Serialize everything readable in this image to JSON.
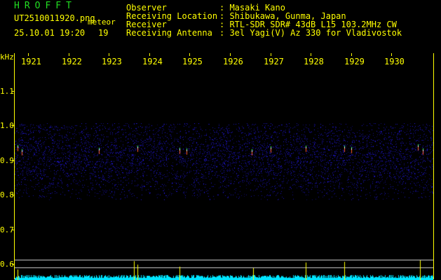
{
  "app": {
    "logo": "HROFFT",
    "filename": "UT2510011920.png",
    "meteor_label": "meteor",
    "datetime": "25.10.01 19:20",
    "meteor_count": "19"
  },
  "info": {
    "observer_label": "Observer",
    "observer_value": ": Masaki Kano",
    "location_label": "Receiving Location",
    "location_value": ": Shibukawa, Gunma, Japan",
    "receiver_label": "Receiver",
    "receiver_value": ": RTL-SDR SDR# 43dB L15 103.2MHz CW",
    "antenna_label": "Receiving Antenna",
    "antenna_value": ": 3el Yagi(V) Az 330 for Vladivostok"
  },
  "axis": {
    "unit": "kHz",
    "y_ticks": [
      "1.1",
      "1.0",
      "0.9",
      "0.8",
      "0.7",
      "0.6"
    ],
    "x_ticks": [
      "1921",
      "1922",
      "1923",
      "1924",
      "1925",
      "1926",
      "1927",
      "1928",
      "1929",
      "1930"
    ]
  },
  "colors": {
    "text": "#ffff00",
    "logo": "#22dd22",
    "background": "#000000",
    "noise": "#1a1aa0",
    "meter": "#00e5ff"
  }
}
